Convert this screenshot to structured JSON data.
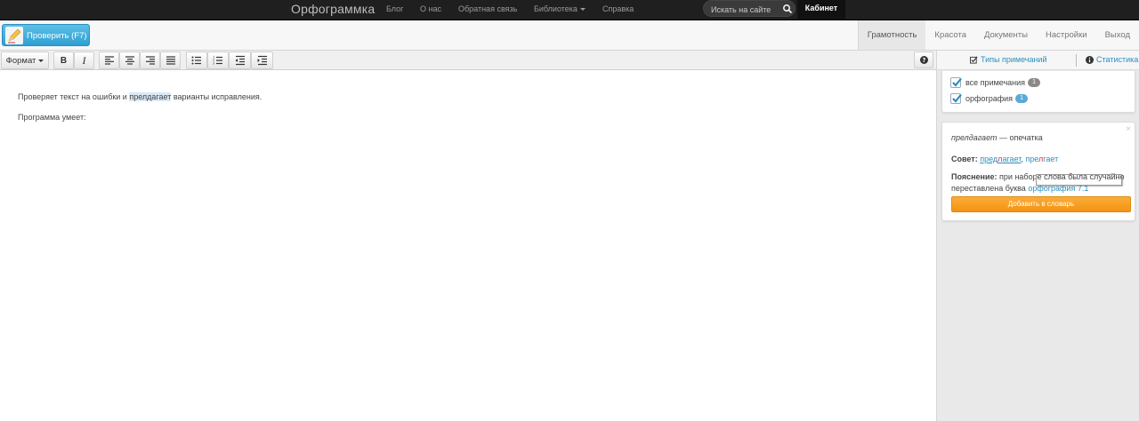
{
  "topbar": {
    "brand": "Орфограммка",
    "nav": [
      "Блог",
      "О нас",
      "Обратная связь",
      "Библиотека",
      "Справка"
    ],
    "search_placeholder": "Искать на сайте",
    "cabinet": "Кабинет"
  },
  "bar2": {
    "check_button": "Проверить (F7)",
    "tabs": [
      "Грамотность",
      "Красота",
      "Документы",
      "Настройки",
      "Выход"
    ]
  },
  "toolbar": {
    "format": "Формат",
    "bold": "B",
    "italic": "I"
  },
  "editor": {
    "line1_before": "Проверяет текст на ошибки и ",
    "line1_highlight": "прелдагает",
    "line1_after": " варианты исправления.",
    "line2": "Программа умеет:"
  },
  "panel": {
    "types_link": "Типы примечаний",
    "stats_link": "Статистика",
    "filters": [
      {
        "label": "все примечания",
        "count": "1",
        "badge_color": "#8a8a8a"
      },
      {
        "label": "орфография",
        "count": "1",
        "badge_color": "#5aa9d6"
      }
    ],
    "card": {
      "word": "прелдагает",
      "dash_type": " — опечатка",
      "advice_label": "Совет:",
      "suggestion1_a": "пред",
      "suggestion1_b": "л",
      "suggestion1_c": "агает",
      "comma": ",",
      "suggestion2_a": "пре",
      "suggestion2_b": "л",
      "suggestion2_c": "гает",
      "explain_label": "Пояснение:",
      "explain_text1": " при наборе слова была случайно",
      "explain_text2": "переставлена буква ",
      "explain_link": "орфография 7.1",
      "add_button": "Добавить в словарь",
      "close": "×"
    }
  }
}
